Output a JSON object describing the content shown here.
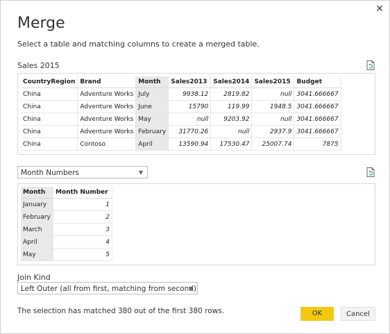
{
  "dialog": {
    "title": "Merge",
    "subtitle": "Select a table and matching columns to create a merged table.",
    "close_glyph": "✕",
    "ok_label": "OK",
    "cancel_label": "Cancel",
    "status": "The selection has matched 380 out of the first 380 rows.",
    "accent_color": "#f2c811"
  },
  "first_table": {
    "name": "Sales 2015",
    "columns": [
      "CountryRegion",
      "Brand",
      "Month",
      "Sales2013",
      "Sales2014",
      "Sales2015",
      "Budget"
    ],
    "selected_column": "Month",
    "rows": [
      [
        "China",
        "Adventure Works",
        "July",
        "9938.12",
        "2819.82",
        "null",
        "3041.666667"
      ],
      [
        "China",
        "Adventure Works",
        "June",
        "15790",
        "119.99",
        "1948.5",
        "3041.666667"
      ],
      [
        "China",
        "Adventure Works",
        "May",
        "null",
        "9203.92",
        "null",
        "3041.666667"
      ],
      [
        "China",
        "Adventure Works",
        "February",
        "31770.26",
        "null",
        "2937.9",
        "3041.666667"
      ],
      [
        "China",
        "Contoso",
        "April",
        "13590.94",
        "17530.47",
        "25007.74",
        "7875"
      ]
    ]
  },
  "second_table": {
    "selected": "Month Numbers",
    "columns": [
      "Month",
      "Month Number"
    ],
    "selected_column": "Month",
    "rows": [
      [
        "January",
        "1"
      ],
      [
        "February",
        "2"
      ],
      [
        "March",
        "3"
      ],
      [
        "April",
        "4"
      ],
      [
        "May",
        "5"
      ]
    ]
  },
  "join": {
    "label": "Join Kind",
    "selected": "Left Outer (all from first, matching from second)"
  },
  "icons": {
    "close": "close-icon",
    "refresh": "refresh-icon",
    "dropdown_arrow": "chevron-down-icon"
  }
}
